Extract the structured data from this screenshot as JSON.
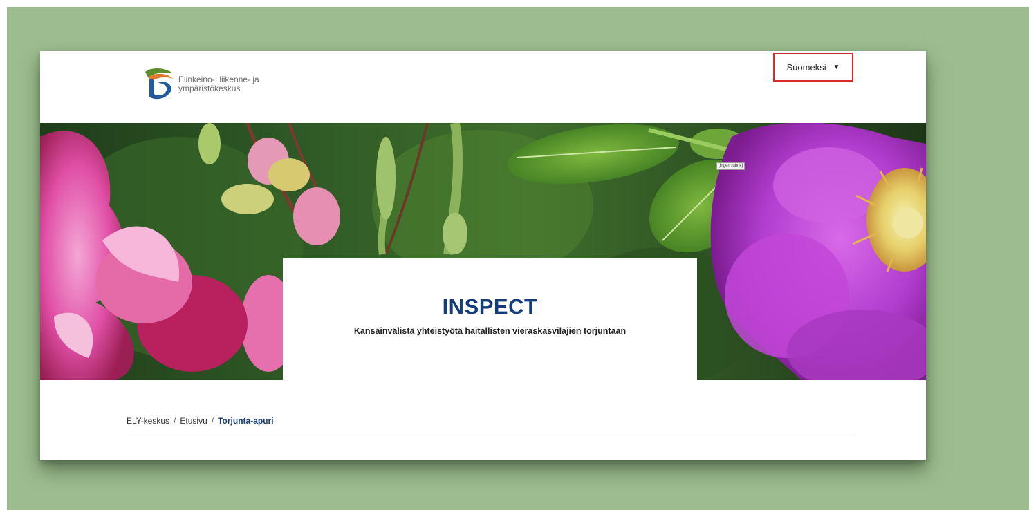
{
  "header": {
    "logo_line1": "Elinkeino-, liikenne- ja",
    "logo_line2": "ympäristökeskus",
    "language": "Suomeksi"
  },
  "hero": {
    "image_caption": "[Ingen rubrik]",
    "title": "INSPECT",
    "subtitle": "Kansainvälistä yhteistyötä haitallisten vieraskasvilajien torjuntaan"
  },
  "breadcrumb": {
    "items": [
      "ELY-keskus",
      "Etusivu",
      "Torjunta-apuri"
    ],
    "separator": "/"
  },
  "colors": {
    "accent": "#123d7a",
    "highlight_border": "#d62b2b",
    "background": "#9dbd90"
  }
}
